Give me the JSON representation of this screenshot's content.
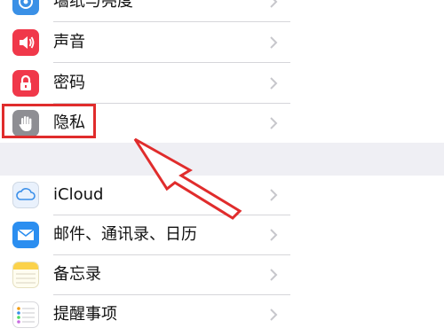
{
  "settings": {
    "items": [
      {
        "label": "墙纸与亮度",
        "icon": "flower-icon",
        "color": "#3a90e6"
      },
      {
        "label": "声音",
        "icon": "speaker-icon",
        "color": "#f0384a"
      },
      {
        "label": "密码",
        "icon": "lock-icon",
        "color": "#f0384a"
      },
      {
        "label": "隐私",
        "icon": "hand-icon",
        "color": "#8e8e93"
      }
    ],
    "items2": [
      {
        "label": "iCloud",
        "icon": "cloud-icon",
        "color": "#3a8fe9"
      },
      {
        "label": "邮件、通讯录、日历",
        "icon": "mail-icon",
        "color": "#2b8ef0"
      },
      {
        "label": "备忘录",
        "icon": "notes-icon",
        "color": "#fbd24a"
      },
      {
        "label": "提醒事项",
        "icon": "reminders-icon",
        "color": "#ffffff"
      }
    ]
  },
  "annotation": {
    "color": "#e02c2c"
  }
}
